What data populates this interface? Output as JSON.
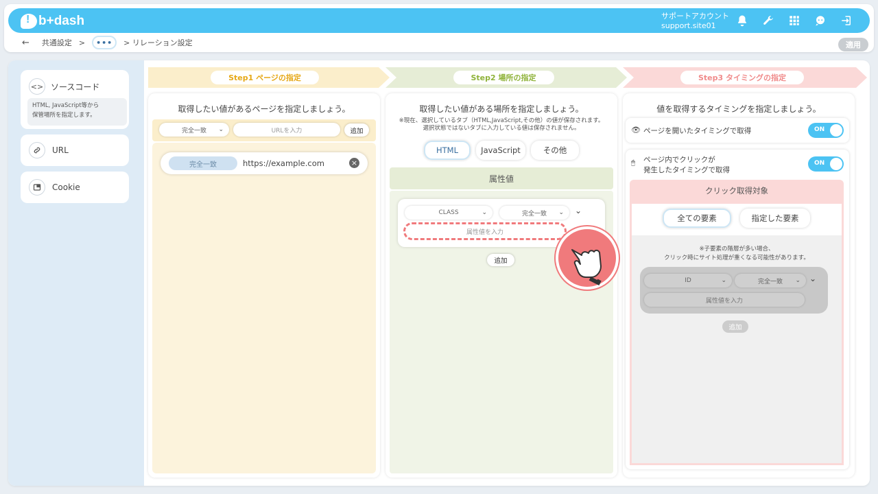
{
  "header": {
    "logo_text": "b+dash",
    "account_label": "サポートアカウント",
    "account_site": "support.site01"
  },
  "breadcrumb": {
    "back": "←",
    "item1": "共通設定",
    "sep": ">",
    "dots": "•••",
    "current": "> リレーション設定",
    "apply": "適用"
  },
  "sidebar": {
    "source_code": {
      "icon": "<>",
      "label": "ソースコード",
      "desc_line1": "HTML, JavaScript等から",
      "desc_line2": "保管場所を指定します。"
    },
    "url": {
      "label": "URL"
    },
    "cookie": {
      "label": "Cookie"
    }
  },
  "steps": {
    "step1": "Step1 ページの指定",
    "step2": "Step2 場所の指定",
    "step3": "Step3 タイミングの指定"
  },
  "col1": {
    "title": "取得したい値があるページを指定しましょう。",
    "match_select": "完全一致",
    "url_placeholder": "URLを入力",
    "add": "追加",
    "row_match": "完全一致",
    "row_url": "https://example.com"
  },
  "col2": {
    "title": "取得したい値がある場所を指定しましょう。",
    "note_line1": "※現在、選択しているタブ（HTML,JavaScript,その他）の値が保存されます。",
    "note_line2": "選択状態ではないタブに入力している値は保存されません。",
    "tabs": [
      "HTML",
      "JavaScript",
      "その他"
    ],
    "section": "属性値",
    "attr_select": "CLASS",
    "match_select": "完全一致",
    "attr_placeholder": "属性値を入力",
    "add": "追加"
  },
  "col3": {
    "title": "値を取得するタイミングを指定しましょう。",
    "opt1": "ページを開いたタイミングで取得",
    "opt2_line1": "ページ内でクリックが",
    "opt2_line2": "発生したタイミングで取得",
    "toggle_on": "ON",
    "target_header": "クリック取得対象",
    "target_tabs": [
      "全ての要素",
      "指定した要素"
    ],
    "note_line1": "※子要素の階層が多い場合、",
    "note_line2": "クリック時にサイト処理が重くなる可能性があります。",
    "attr_select": "ID",
    "match_select": "完全一致",
    "attr_placeholder": "属性値を入力",
    "add": "追加"
  },
  "colors": {
    "brand": "#4cc3f3",
    "step1": "#fbeecb",
    "step2": "#e6edd6",
    "step3": "#fbd9d8",
    "pointer": "#f07a7c"
  }
}
